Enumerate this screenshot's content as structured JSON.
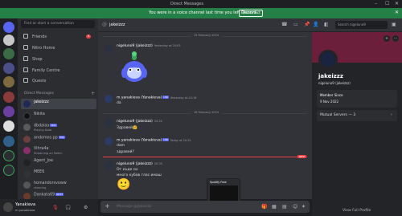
{
  "window": {
    "title": "Direct Messages"
  },
  "notice": {
    "message": "You were in a voice channel last time you left Discord.",
    "button": "Reconnect"
  },
  "search": {
    "placeholder": "Find or start a conversation"
  },
  "nav": [
    {
      "label": "Friends",
      "badge": "6",
      "icon": "friends-icon"
    },
    {
      "label": "Nitro Home",
      "icon": "nitro-icon"
    },
    {
      "label": "Shop",
      "icon": "shop-icon"
    },
    {
      "label": "Family Centre",
      "icon": "family-icon"
    },
    {
      "label": "Quests",
      "icon": "quests-icon"
    }
  ],
  "dm_header": "Direct Messages",
  "dms": [
    {
      "name": "jakeizzz",
      "status": "",
      "selected": true,
      "color": "#1e2a55"
    },
    {
      "name": "Nikita",
      "status": "",
      "color": "#222"
    },
    {
      "name": "dbdalaa",
      "status": "Playing Dota",
      "color": "#5a5a5a",
      "tags": [
        "TDC"
      ]
    },
    {
      "name": "andomos.pp",
      "status": "",
      "color": "#6b3f3f",
      "tags": [
        "TDC"
      ]
    },
    {
      "name": "Vihra4a",
      "status": "Streaming on Twitch",
      "color": "#8a2f6b"
    },
    {
      "name": "Agent_Joe",
      "status": "",
      "color": "#222"
    },
    {
      "name": "MEE6",
      "status": "",
      "color": "#333",
      "tags": [
        "APP"
      ]
    },
    {
      "name": "homandorsvoww",
      "status": "cheering",
      "color": "#555"
    },
    {
      "name": "Dankata69",
      "status": "",
      "color": "#6b3a2a",
      "tags": [
        "NCTY"
      ]
    }
  ],
  "user": {
    "name": "Yanakieva",
    "handle": "m.yanakieva"
  },
  "chat": {
    "recipient": "jakeizzz",
    "search_placeholder": "Search nigeluno9",
    "composer_placeholder": "Message @jakeizzz",
    "date1": "15 February 2024",
    "date2": "18 February 2024",
    "date3": "",
    "messages": [
      {
        "author": "nigeluno9 (jakeizzz)",
        "time": "Yesterday at 20:03",
        "lines": [
          ""
        ]
      },
      {
        "author": "m.yanakieva (Yanakieva)",
        "tag": "UNI",
        "time": "Yesterday at 20:16",
        "lines": [
          "da"
        ]
      },
      {
        "author": "nigeluno9 (jakeizzz)",
        "time": "20:22",
        "lines": [
          "Здравей🤗"
        ]
      },
      {
        "author": "m.yanakieva (Yanakieva)",
        "tag": "UNI",
        "time": "Today at 20:31",
        "lines": [
          "dam",
          "здравей?"
        ]
      },
      {
        "author": "nigeluno9 (jakeizzz)",
        "time": "20:35",
        "lines": [
          "От къде си",
          "много кубав глас имаш",
          "🙂"
        ]
      }
    ],
    "new_label": "NEW"
  },
  "profile": {
    "name": "jakeizzz",
    "username": "nigeluno9 (jakeizzz)",
    "member_since_label": "Member Since",
    "member_since": "9 Nov 2022",
    "mutual_servers": "Mutual Servers — 3",
    "view_full": "View Full Profile"
  },
  "spotify": {
    "title": "Spotify Free"
  }
}
